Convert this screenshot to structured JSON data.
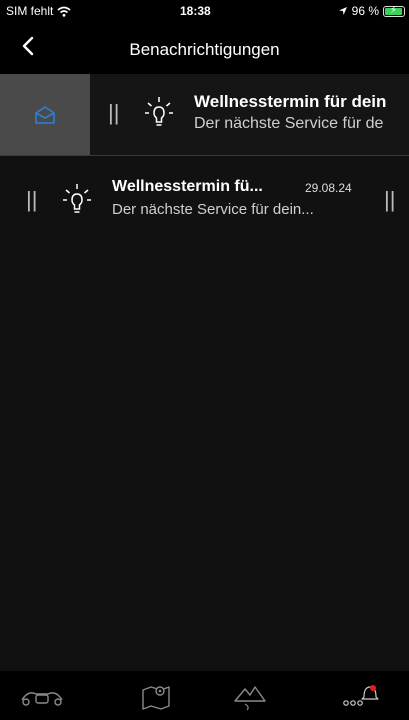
{
  "status_bar": {
    "carrier": "SIM fehlt",
    "time": "18:38",
    "battery": "96 %"
  },
  "nav": {
    "title": "Benachrichtigungen",
    "back_icon": "chevron-left-icon"
  },
  "swiped_row": {
    "action_icon": "envelope-open-icon",
    "title": "Wellnesstermin für dein",
    "subtitle": "Der nächste Service für de"
  },
  "notifications": [
    {
      "title": "Wellnesstermin fü...",
      "date": "29.08.24",
      "subtitle": "Der nächste Service für dein..."
    }
  ],
  "tabbar": {
    "tabs": [
      {
        "icon": "scooter-icon"
      },
      {
        "icon": "map-icon"
      },
      {
        "icon": "mountain-icon"
      },
      {
        "icon": "more-notification-icon"
      }
    ]
  },
  "colors": {
    "accent": "#2f7fd6",
    "badge": "#e02020",
    "background": "#111111",
    "swipe_action": "#4a4a4a"
  }
}
